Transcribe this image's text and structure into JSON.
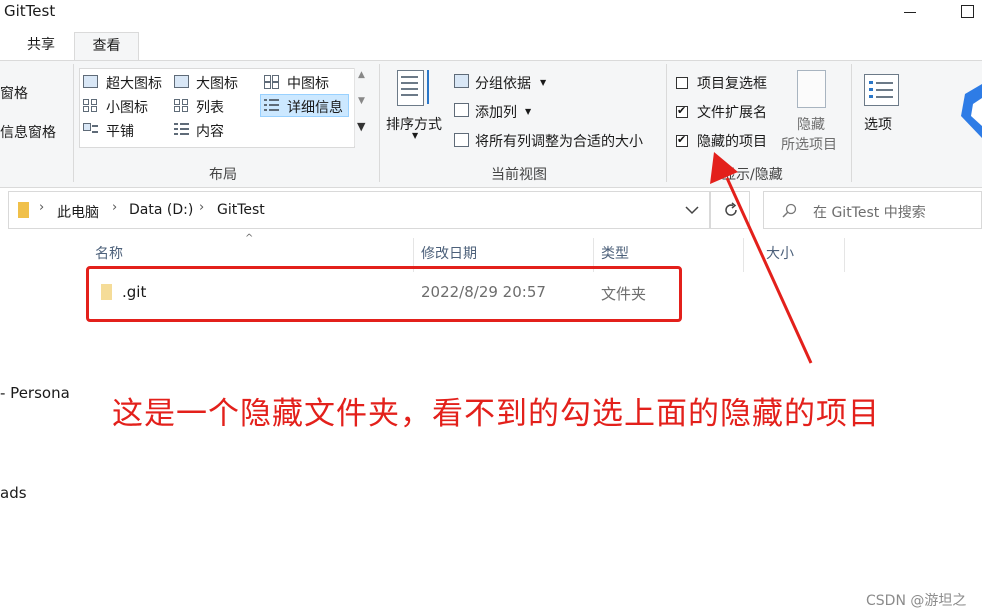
{
  "window": {
    "title": "GitTest"
  },
  "ribbon": {
    "tabs": [
      {
        "label": "共享"
      },
      {
        "label": "查看"
      }
    ],
    "panes": {
      "navigation_pane_fragment": "窗格",
      "details_pane_fragment": "信息窗格"
    },
    "layout": {
      "group_label": "布局",
      "items": {
        "extra_large_icons": "超大图标",
        "large_icons": "大图标",
        "medium_icons": "中图标",
        "small_icons": "小图标",
        "list": "列表",
        "details": "详细信息",
        "tiles": "平铺",
        "content": "内容"
      }
    },
    "current_view": {
      "group_label": "当前视图",
      "sort_by": "排序方式",
      "group_by": "分组依据",
      "add_columns": "添加列",
      "size_all_columns": "将所有列调整为合适的大小"
    },
    "show_hide": {
      "group_label": "显示/隐藏",
      "item_checkboxes": {
        "label": "项目复选框",
        "checked": false
      },
      "file_name_extensions": {
        "label": "文件扩展名",
        "checked": true
      },
      "hidden_items": {
        "label": "隐藏的项目",
        "checked": true
      },
      "hide_selected_line1": "隐藏",
      "hide_selected_line2": "所选项目"
    },
    "options_label": "选项"
  },
  "address": {
    "breadcrumb": [
      "此电脑",
      "Data (D:)",
      "GitTest"
    ],
    "search_placeholder": "在 GitTest 中搜索"
  },
  "nav_pane": {
    "items": [
      "- Persona",
      "ads"
    ]
  },
  "file_list": {
    "columns": [
      "名称",
      "修改日期",
      "类型",
      "大小"
    ],
    "rows": [
      {
        "name": ".git",
        "modified": "2022/8/29 20:57",
        "type": "文件夹",
        "size": ""
      }
    ]
  },
  "annotation": {
    "text": "这是一个隐藏文件夹，看不到的勾选上面的隐藏的项目",
    "color": "#e3201b"
  },
  "watermark": "CSDN @游坦之"
}
